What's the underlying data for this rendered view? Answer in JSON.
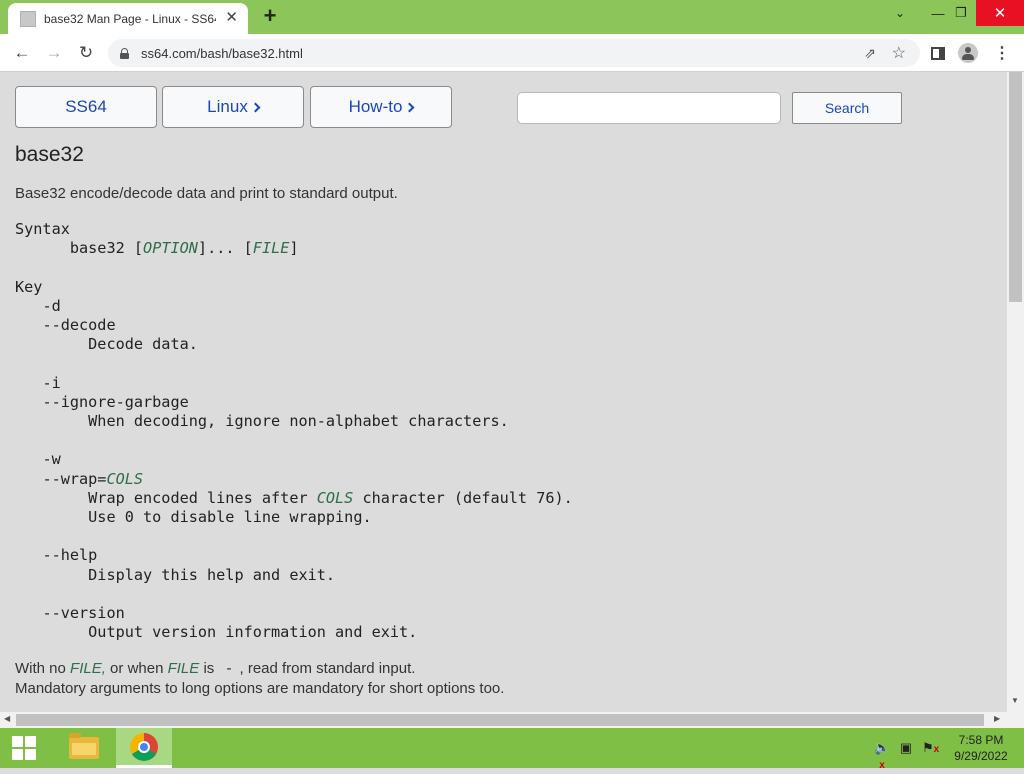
{
  "browser": {
    "tab_title": "base32 Man Page - Linux - SS64.",
    "tab_close": "✕",
    "new_tab": "+",
    "url": "ss64.com/bash/base32.html"
  },
  "page": {
    "nav": {
      "ss64": "SS64",
      "linux": "Linux",
      "howto": "How-to"
    },
    "search": {
      "placeholder": "",
      "value": "",
      "button": "Search"
    },
    "title": "base32",
    "summary": "Base32 encode/decode data and print to standard output.",
    "syntax_label": "Syntax",
    "syntax": {
      "command": "base32",
      "option": "OPTION",
      "ellipsis": "]... [",
      "file": "FILE"
    },
    "key_label": "Key",
    "options": [
      {
        "flags": [
          "-d",
          "--decode"
        ],
        "desc": [
          "Decode data."
        ]
      },
      {
        "flags": [
          "-i",
          "--ignore-garbage"
        ],
        "desc": [
          "When decoding, ignore non-alphabet characters."
        ]
      },
      {
        "flags": [
          "-w"
        ],
        "flag_wrap": "--wrap=",
        "flag_wrap_arg": "COLS",
        "desc_wrap_pre": "Wrap encoded lines after ",
        "desc_wrap_arg": "COLS",
        "desc_wrap_post": " character (default 76).",
        "desc_line2": "Use 0 to disable line wrapping."
      },
      {
        "flags": [
          "--help"
        ],
        "desc": [
          "Display this help and exit."
        ]
      },
      {
        "flags": [
          "--version"
        ],
        "desc": [
          "Output version information and exit."
        ]
      }
    ],
    "footer": {
      "line1_a": "With no ",
      "line1_file1": "FILE,",
      "line1_b": " or when ",
      "line1_file2": "FILE",
      "line1_c": " is ",
      "line1_dash": "-",
      "line1_d": ", read from standard input.",
      "line2": "Mandatory arguments to long options are mandatory for short options too."
    }
  },
  "taskbar": {
    "time": "7:58 PM",
    "date": "9/29/2022"
  }
}
